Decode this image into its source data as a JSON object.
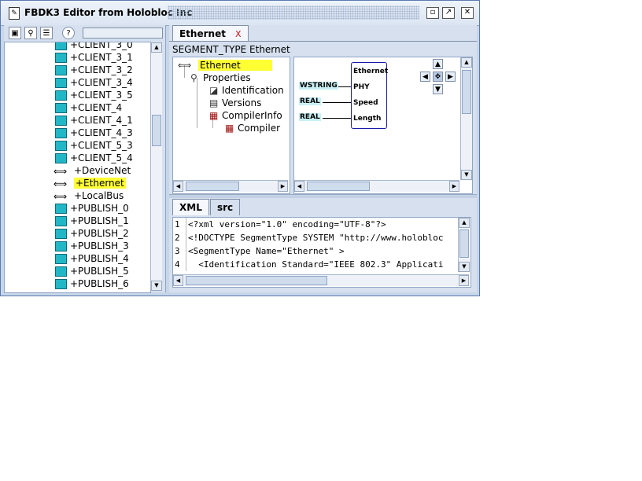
{
  "window": {
    "title": "FBDK3 Editor from Holobloc Inc"
  },
  "toolbar": {
    "icons": [
      "save-icon",
      "find-icon",
      "checklist-icon",
      "help-icon"
    ]
  },
  "library_tree": {
    "items": [
      {
        "label": "+CLIENT_3_0",
        "kind": "block"
      },
      {
        "label": "+CLIENT_3_1",
        "kind": "block"
      },
      {
        "label": "+CLIENT_3_2",
        "kind": "block"
      },
      {
        "label": "+CLIENT_3_4",
        "kind": "block"
      },
      {
        "label": "+CLIENT_3_5",
        "kind": "block"
      },
      {
        "label": "+CLIENT_4",
        "kind": "block"
      },
      {
        "label": "+CLIENT_4_1",
        "kind": "block"
      },
      {
        "label": "+CLIENT_4_3",
        "kind": "block"
      },
      {
        "label": "+CLIENT_5_3",
        "kind": "block"
      },
      {
        "label": "+CLIENT_5_4",
        "kind": "block"
      },
      {
        "label": "+DeviceNet",
        "kind": "segment"
      },
      {
        "label": "+Ethernet",
        "kind": "segment",
        "selected": true
      },
      {
        "label": "+LocalBus",
        "kind": "segment"
      },
      {
        "label": "+PUBLISH_0",
        "kind": "block"
      },
      {
        "label": "+PUBLISH_1",
        "kind": "block"
      },
      {
        "label": "+PUBLISH_2",
        "kind": "block"
      },
      {
        "label": "+PUBLISH_3",
        "kind": "block"
      },
      {
        "label": "+PUBLISH_4",
        "kind": "block"
      },
      {
        "label": "+PUBLISH_5",
        "kind": "block"
      },
      {
        "label": "+PUBLISH_6",
        "kind": "block"
      }
    ]
  },
  "editor": {
    "tab": {
      "label": "Ethernet",
      "close": "X"
    },
    "header": "SEGMENT_TYPE Ethernet",
    "props_tree": [
      {
        "label": "Ethernet",
        "selected": true
      },
      {
        "label": "Properties"
      },
      {
        "label": "Identification"
      },
      {
        "label": "Versions"
      },
      {
        "label": "CompilerInfo"
      },
      {
        "label": "Compiler"
      }
    ],
    "diagram": {
      "block_name": "Ethernet",
      "ports": [
        {
          "type": "WSTRING",
          "name": "PHY"
        },
        {
          "type": "REAL",
          "name": "Speed"
        },
        {
          "type": "REAL",
          "name": "Length"
        }
      ]
    },
    "source_tabs": [
      "XML",
      "src"
    ],
    "code_lines": [
      {
        "num": "1",
        "text": "<?xml version=\"1.0\" encoding=\"UTF-8\"?>"
      },
      {
        "num": "2",
        "text": "<!DOCTYPE SegmentType SYSTEM \"http://www.holobloc"
      },
      {
        "num": "3",
        "text": "<SegmentType Name=\"Ethernet\" >"
      },
      {
        "num": "4",
        "text": "  <Identification Standard=\"IEEE 802.3\" Applicati"
      }
    ]
  }
}
